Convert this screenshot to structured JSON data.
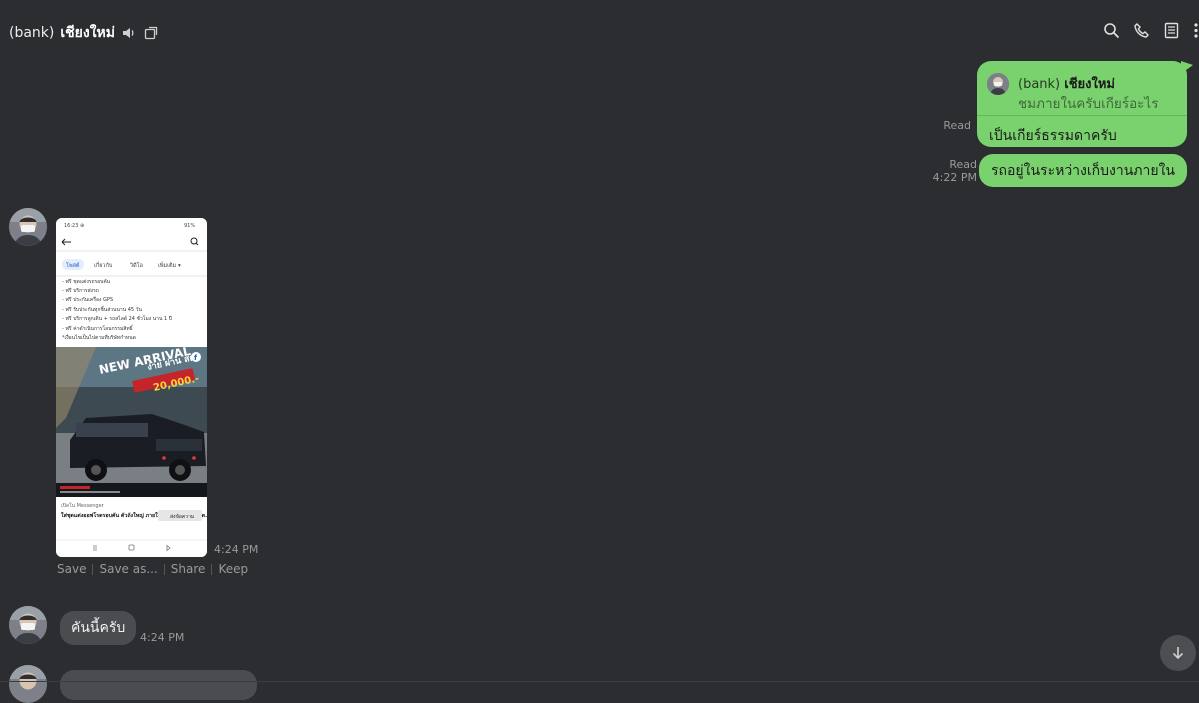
{
  "header": {
    "title_prefix": "(bank)",
    "title_name": "เชียงใหม่"
  },
  "messages": {
    "reply": {
      "quoted_sender_prefix": "(bank)",
      "quoted_sender_name": "เชียงใหม่",
      "quoted_snippet": "ชมภายในครับเกียร์อะไร",
      "text": "เป็นเกียร์ธรรมดาครับ",
      "status": "Read"
    },
    "out2": {
      "text": "รถอยู่ในระหว่างเก็บงานภายใน",
      "status": "Read",
      "time": "4:22 PM"
    },
    "image_msg": {
      "time": "4:24 PM",
      "actions": [
        "Save",
        "Save as...",
        "Share",
        "Keep"
      ],
      "screenshot": {
        "status_time": "16:23 ⊕",
        "status_right": "91%",
        "tabs": [
          "โพสต์",
          "เกี่ยวกับ",
          "วิดีโอ",
          "เพิ่มเติม ▾"
        ],
        "lines": [
          "- ฟรี ชุดแต่งรถรอบคัน",
          "- ฟรี บริการส่งรถ",
          "- ฟรี ประกันเครื่อง GPS",
          "- ฟรี รับประกันทุกชิ้นส่วนนาน 45 วัน",
          "- ฟรี บริการลูกเดิน + รถสไลด์ 24 ชั่วโมง นาน 1 ปี",
          "- ฟรี ค่าดำเนินการโอนกรรมสิทธิ์",
          "*เงื่อนไขเป็นไปตามที่บริษัทกำหนด"
        ],
        "banner_title": "NEW ARRIVAL",
        "banner_sub": "ง่าย ผ่าน สด",
        "banner_price": "20,000.-",
        "messenger_label": "เปิดใน Messenger",
        "messenger_text": "ใส่ชุดแต่งออฟโรดรอบคัน ตัวถังใหญ่ ภายในกว้าง ขอดคุณ ไม่ต...",
        "messenger_btn": "ส่งข้อความ"
      }
    },
    "in1": {
      "text": "คันนี้ครับ",
      "time": "4:24 PM"
    }
  },
  "icons": [
    "speaker-icon",
    "external-window-icon",
    "search-icon",
    "phone-icon",
    "notes-icon",
    "more-icon",
    "scroll-down-icon"
  ],
  "colors": {
    "background": "#2c2d30",
    "outgoing_bubble": "#7ad26e",
    "incoming_bubble": "#4b4c50",
    "meta_text": "#9a9a9a"
  }
}
